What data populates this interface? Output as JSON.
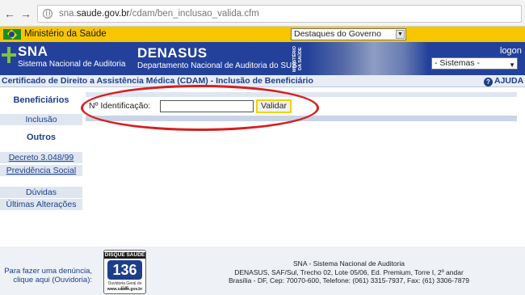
{
  "browser": {
    "url_prefix": "sna.",
    "url_domain": "saude.gov.br",
    "url_path": "/cdam/ben_inclusao_valida.cfm"
  },
  "gov_bar": {
    "ministry": "Ministério da Saúde",
    "select_value": "Destaques do Governo"
  },
  "header": {
    "sna_title": "SNA",
    "sna_subtitle": "Sistema Nacional de Auditoria",
    "denasus_title": "DENASUS",
    "denasus_subtitle": "Departamento Nacional de Auditoria do SUS",
    "vertical_label": "MINISTÉRIO DA SAÚDE",
    "logon": "logon",
    "systems_select": "- Sistemas -"
  },
  "title_bar": {
    "title": "Certificado de Direito a Assistência Médica (CDAM) - Inclusão de Beneficiário",
    "help": "AJUDA"
  },
  "sidebar": {
    "beneficiarios": "Beneficiários",
    "inclusao": "Inclusão",
    "outros": "Outros",
    "decreto": "Decreto 3.048/99",
    "previdencia": "Previdência Social",
    "duvidas": "Dúvidas",
    "ultimas": "Últimas Alterações"
  },
  "form": {
    "id_label": "Nº Identificação:",
    "id_value": "",
    "validar": "Validar"
  },
  "footer": {
    "denuncia_line1": "Para fazer uma denúncia,",
    "denuncia_line2": "clique aqui (Ouvidoria):",
    "disque_title": "DISQUE SAÚDE",
    "disque_number": "136",
    "disque_sub": "Ouvidoria Geral do SUS",
    "disque_url": "www.saude.gov.br",
    "address_line1": "SNA - Sistema Nacional de Auditoria",
    "address_line2": "DENASUS, SAF/Sul, Trecho 02, Lote 05/06, Ed. Premium, Torre I, 2º andar",
    "address_line3": "Brasília - DF, Cep: 70070-600, Telefone: (061) 3315-7937, Fax: (61) 3306-7879"
  },
  "colors": {
    "header_blue": "#23419a",
    "gov_yellow": "#f7c600",
    "annotation_red": "#d62020",
    "link_blue": "#1d3e8a"
  },
  "icons": [
    "back-arrow-icon",
    "forward-arrow-icon",
    "globe-icon",
    "brazil-flag-icon",
    "sna-cross-icon",
    "help-icon",
    "chevron-down-icon"
  ]
}
